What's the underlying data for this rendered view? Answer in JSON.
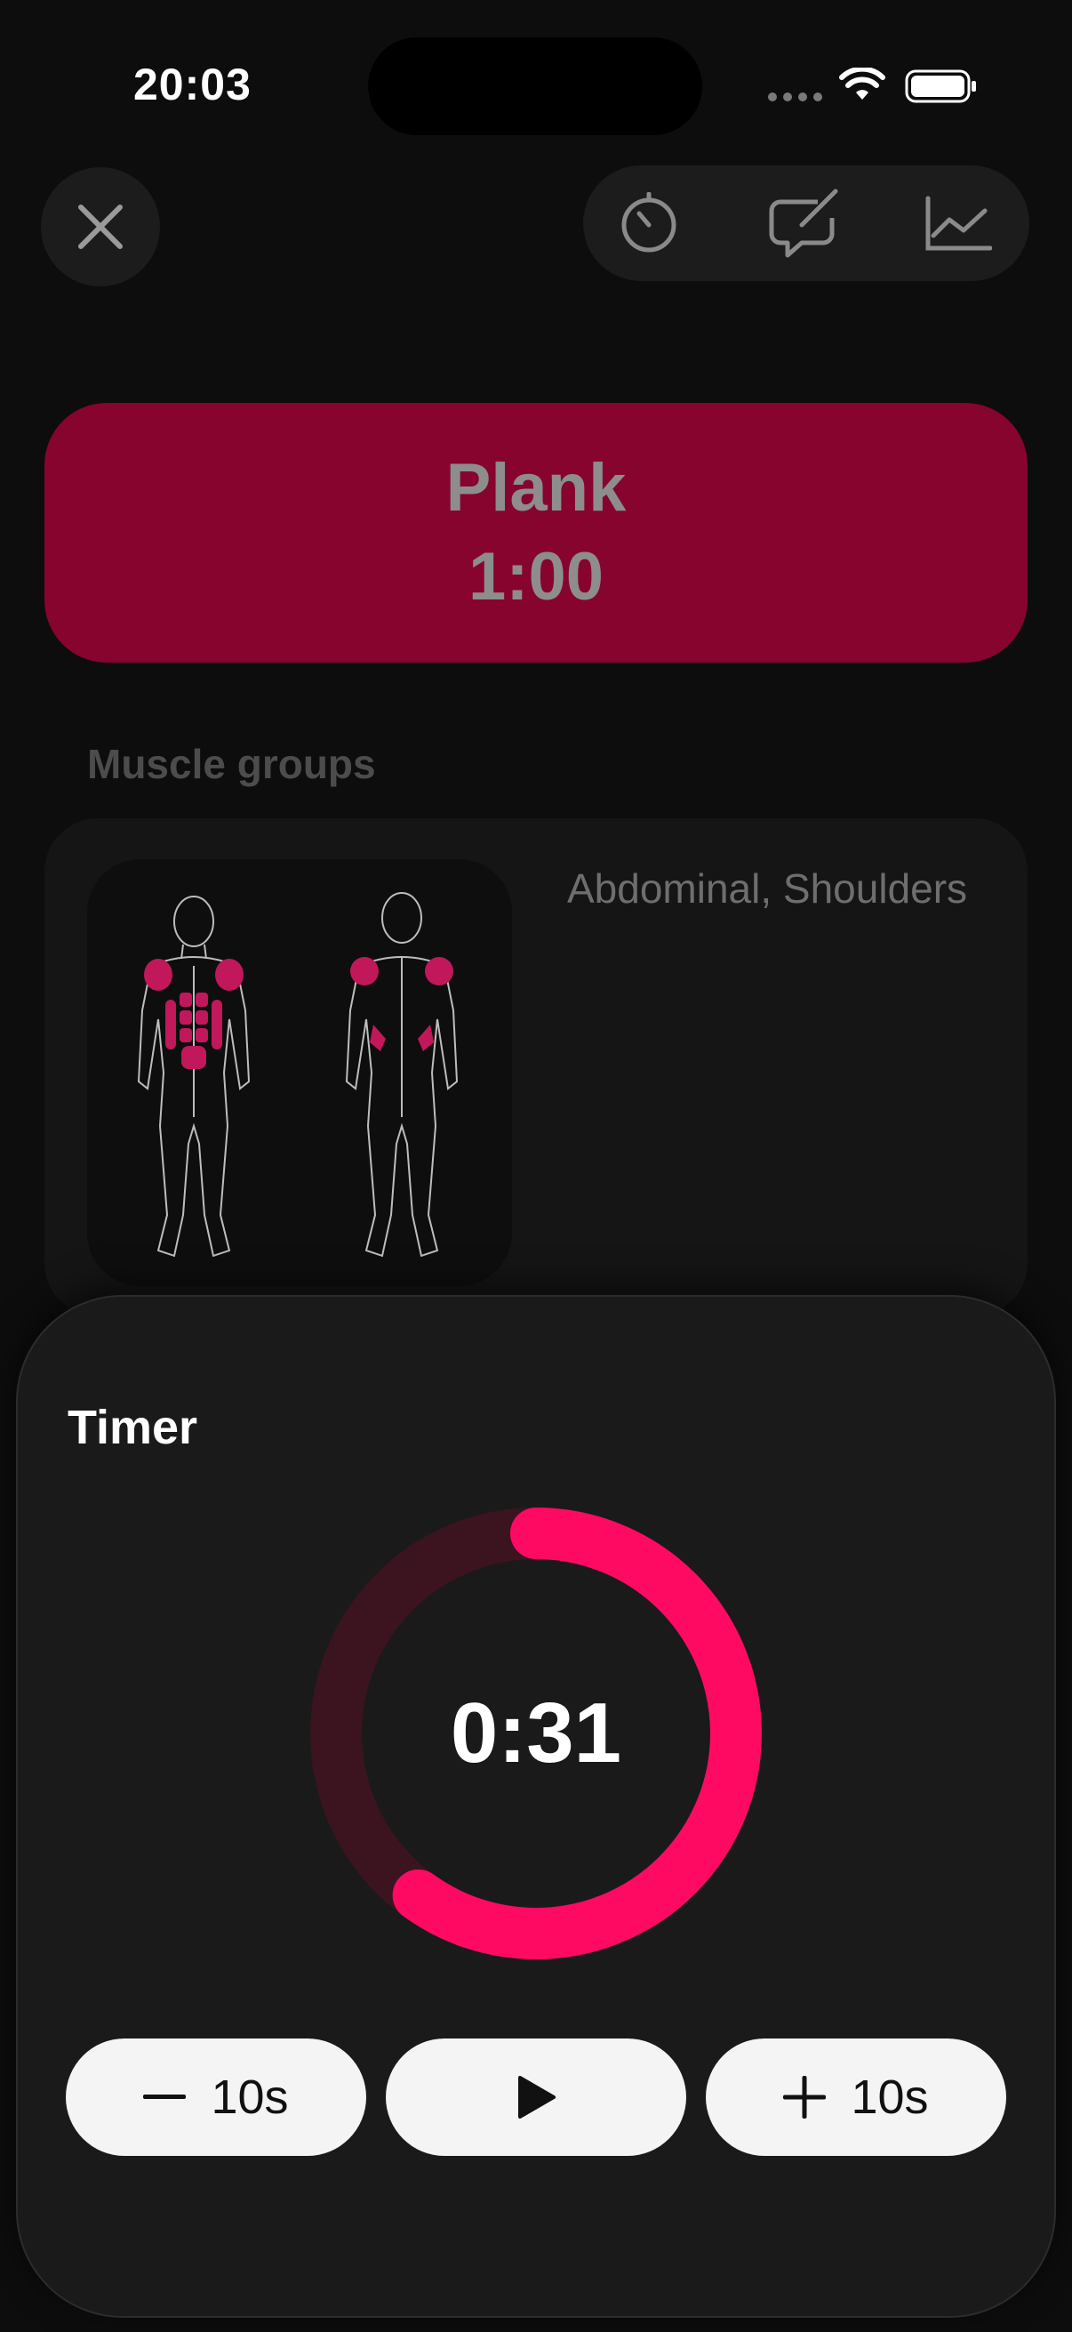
{
  "status_bar": {
    "time": "20:03"
  },
  "toolbar": {
    "close_icon": "xmark-icon",
    "timer_icon": "stopwatch-icon",
    "notes_icon": "compose-note-icon",
    "stats_icon": "line-chart-icon"
  },
  "exercise": {
    "name": "Plank",
    "duration": "1:00",
    "accent_color": "#87042f"
  },
  "muscles": {
    "section_title": "Muscle groups",
    "groups": "Abdominal, Shoulders",
    "highlight_color": "#c0185a"
  },
  "timer": {
    "title": "Timer",
    "remaining": "0:31",
    "progress_fraction": 0.6,
    "ring_color": "#ff0a63",
    "track_color": "#3b1420",
    "minus_label": "10s",
    "plus_label": "10s",
    "play_icon": "play-icon"
  }
}
